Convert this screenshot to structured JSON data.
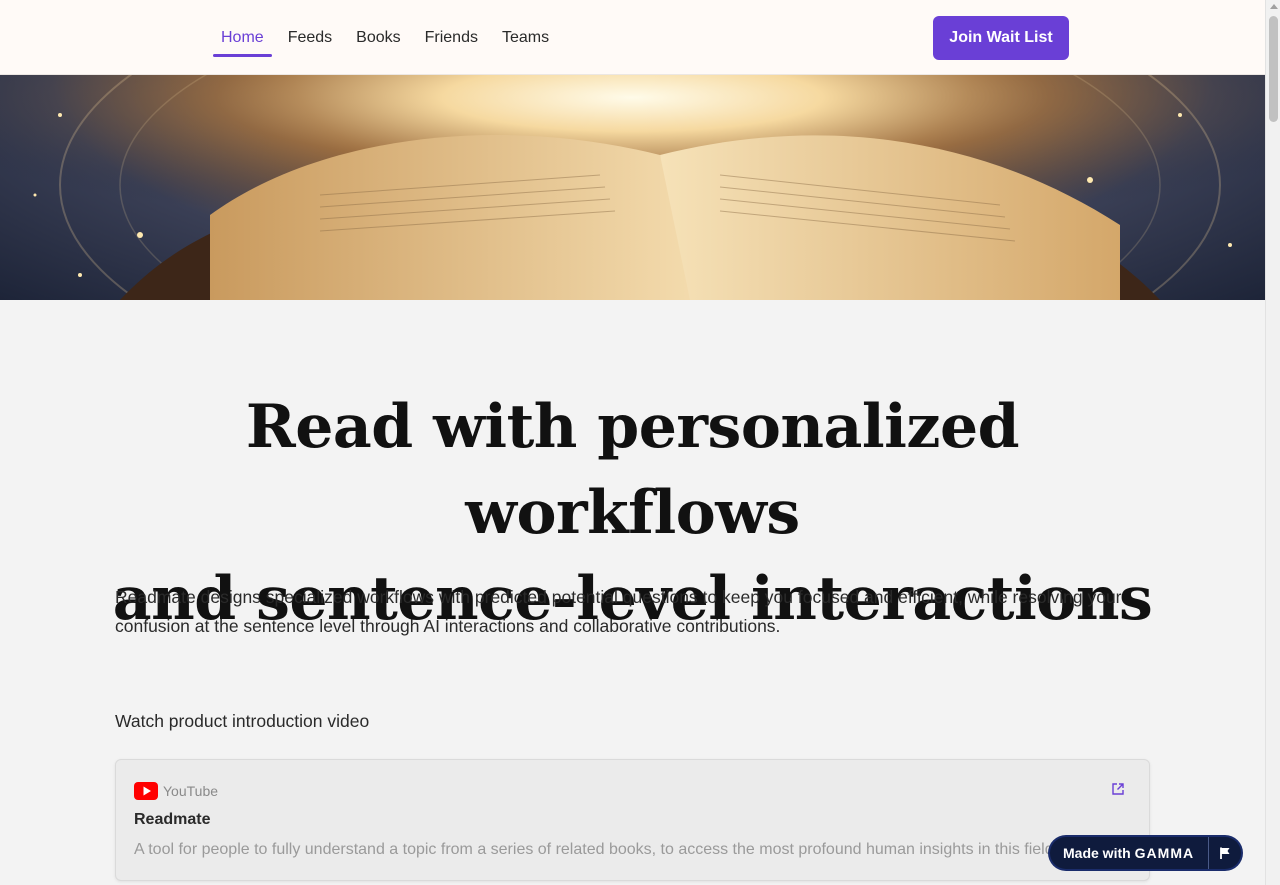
{
  "nav": {
    "items": [
      {
        "label": "Home",
        "active": true
      },
      {
        "label": "Feeds",
        "active": false
      },
      {
        "label": "Books",
        "active": false
      },
      {
        "label": "Friends",
        "active": false
      },
      {
        "label": "Teams",
        "active": false
      }
    ],
    "cta_label": "Join Wait List"
  },
  "hero": {
    "image": "open-book-with-glowing-light-image"
  },
  "main": {
    "title_line1": "Read with personalized workflows",
    "title_line2": "and sentence-level interactions",
    "description": "Readmate designs specialized workflows with predicted potential questions to keep you focused and efficient, while resolving your confusion at the sentence level through AI interactions and collaborative contributions.",
    "video_label": "Watch product introduction video"
  },
  "embed": {
    "source": "YouTube",
    "title": "Readmate",
    "description": "A tool for people to fully understand a topic from a series of related books, to access the most profound human insights in this field."
  },
  "badge": {
    "prefix": "Made with",
    "brand": "GAMMA"
  },
  "colors": {
    "accent": "#6a3fd6",
    "badge_bg": "#0f1b3d",
    "youtube_red": "#ff0000"
  }
}
